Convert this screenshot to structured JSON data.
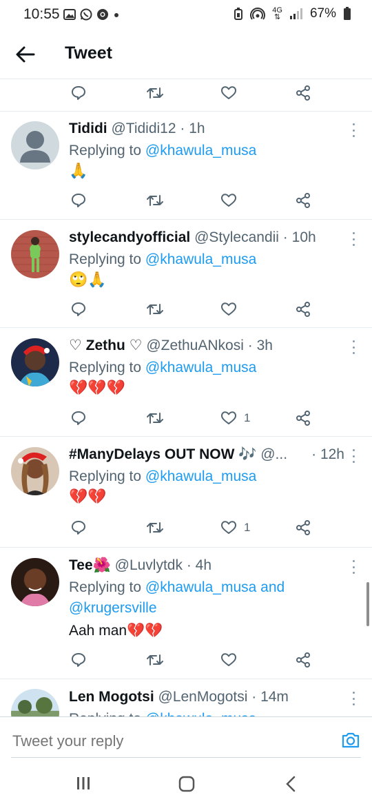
{
  "status_bar": {
    "time": "10:55",
    "network": "4G",
    "battery": "67%",
    "icons_left": [
      "gallery-icon",
      "whatsapp-icon",
      "chrome-icon",
      "dot-icon"
    ],
    "icons_right": [
      "battery-saver-icon",
      "hotspot-icon",
      "network-icon",
      "signal-icon",
      "battery-icon"
    ]
  },
  "header": {
    "title": "Tweet",
    "back_icon": "back-arrow-icon"
  },
  "reply_prefix": "Replying to",
  "tweets": [
    {
      "name": "Tididi",
      "handle": "@Tididi12",
      "time": "1h",
      "mention": "@khawula_musa",
      "text": "🙏",
      "likes": ""
    },
    {
      "name": "stylecandyofficial",
      "handle": "@Stylecandii",
      "time": "10h",
      "mention": "@khawula_musa",
      "text": "🙄🙏",
      "likes": ""
    },
    {
      "name": "♡ Zethu ♡",
      "handle": "@ZethuANkosi",
      "time": "3h",
      "mention": "@khawula_musa",
      "text": "💔💔💔",
      "likes": "1"
    },
    {
      "name": "#ManyDelays OUT NOW 🎶",
      "handle": "@...",
      "time": "12h",
      "mention": "@khawula_musa",
      "text": "💔💔",
      "likes": "1"
    },
    {
      "name": "Tee🌺",
      "handle": "@Luvlytdk",
      "time": "4h",
      "mention": "@khawula_musa",
      "mention_join": "and",
      "mention2": "@krugersville",
      "text": "Aah man💔💔",
      "likes": ""
    },
    {
      "name": "Len Mogotsi",
      "handle": "@LenMogotsi",
      "time": "14m",
      "mention": "@khawula_musa",
      "text": "",
      "likes": ""
    }
  ],
  "reply_bar": {
    "placeholder": "Tweet your reply",
    "camera_icon": "camera-icon"
  },
  "colors": {
    "accent": "#1d9bf0",
    "secondary_text": "#536471",
    "divider": "#e6ecf0"
  }
}
